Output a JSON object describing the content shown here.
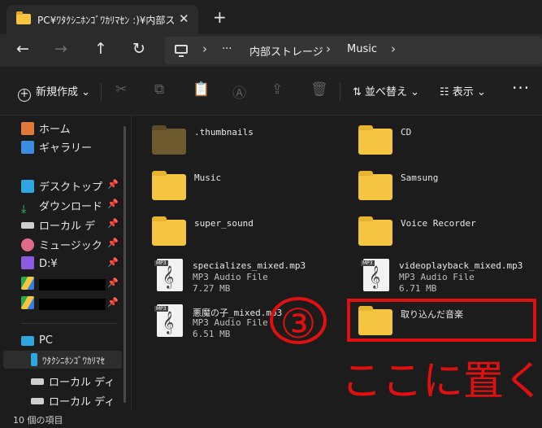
{
  "tab": {
    "title": "PC¥ﾜﾀｸｼﾆﾎﾝｺﾞﾜｶﾘﾏｾﾝ :)¥内部ストレ",
    "close": "✕"
  },
  "newtab": "+",
  "nav": {
    "back": "←",
    "forward": "→",
    "up": "↑",
    "refresh": "↻"
  },
  "address": {
    "overflow": "···",
    "crumbs": [
      "内部ストレージ",
      "Music"
    ],
    "sep": "›"
  },
  "toolbar": {
    "new_label": "新規作成",
    "sort_label": "並べ替え",
    "view_label": "表示",
    "more": "···",
    "icons": {
      "cut": "✂",
      "copy": "⧉",
      "paste": "📋",
      "rename": "Ⓐ",
      "share": "⇪",
      "delete": "🗑"
    }
  },
  "sidebar": {
    "items": [
      {
        "label": "ホーム",
        "icon": "home-icon"
      },
      {
        "label": "ギャラリー",
        "icon": "gallery-icon"
      },
      {
        "label": "デスクトップ",
        "icon": "desktop-icon",
        "pinned": true
      },
      {
        "label": "ダウンロード",
        "icon": "download-icon",
        "pinned": true
      },
      {
        "label": "ローカル デ",
        "icon": "drive-icon",
        "pinned": true
      },
      {
        "label": "ミュージック",
        "icon": "music-icon",
        "pinned": true
      },
      {
        "label": "D:¥",
        "icon": "drive-d-icon",
        "pinned": true
      },
      {
        "label": "",
        "icon": "google-drive-icon",
        "pinned": true
      },
      {
        "label": "",
        "icon": "google-drive-icon",
        "pinned": true
      },
      {
        "label": "PC",
        "icon": "pc-icon"
      },
      {
        "label": "ﾜﾀｸｼﾆﾎﾝｺﾞﾜｶﾘﾏｾ",
        "icon": "phone-icon"
      },
      {
        "label": "ローカル ディ",
        "icon": "drive-icon"
      },
      {
        "label": "ローカル ディ",
        "icon": "drive-icon"
      }
    ]
  },
  "files": [
    {
      "name": ".thumbnails",
      "kind": "folder-hidden"
    },
    {
      "name": "CD",
      "kind": "folder"
    },
    {
      "name": "Music",
      "kind": "folder"
    },
    {
      "name": "Samsung",
      "kind": "folder"
    },
    {
      "name": "super_sound",
      "kind": "folder"
    },
    {
      "name": "Voice Recorder",
      "kind": "folder"
    },
    {
      "name": "specializes_mixed.mp3",
      "kind": "mp3",
      "type": "MP3 Audio File",
      "size": "7.27 MB"
    },
    {
      "name": "videoplayback_mixed.mp3",
      "kind": "mp3",
      "type": "MP3 Audio File",
      "size": "6.71 MB"
    },
    {
      "name": "悪魔の子_mixed.mp3",
      "kind": "mp3",
      "type": "MP3 Audio File",
      "size": "6.51 MB"
    },
    {
      "name": "取り込んだ音楽",
      "kind": "folder"
    }
  ],
  "mp3_tag": "MP3",
  "annotation": {
    "step": "③",
    "text": "ここに置く"
  },
  "status": {
    "count": "10 個の項目"
  },
  "colors": {
    "folder": "#f5c542",
    "annotation": "#e01010",
    "background": "#1c1c1c"
  }
}
